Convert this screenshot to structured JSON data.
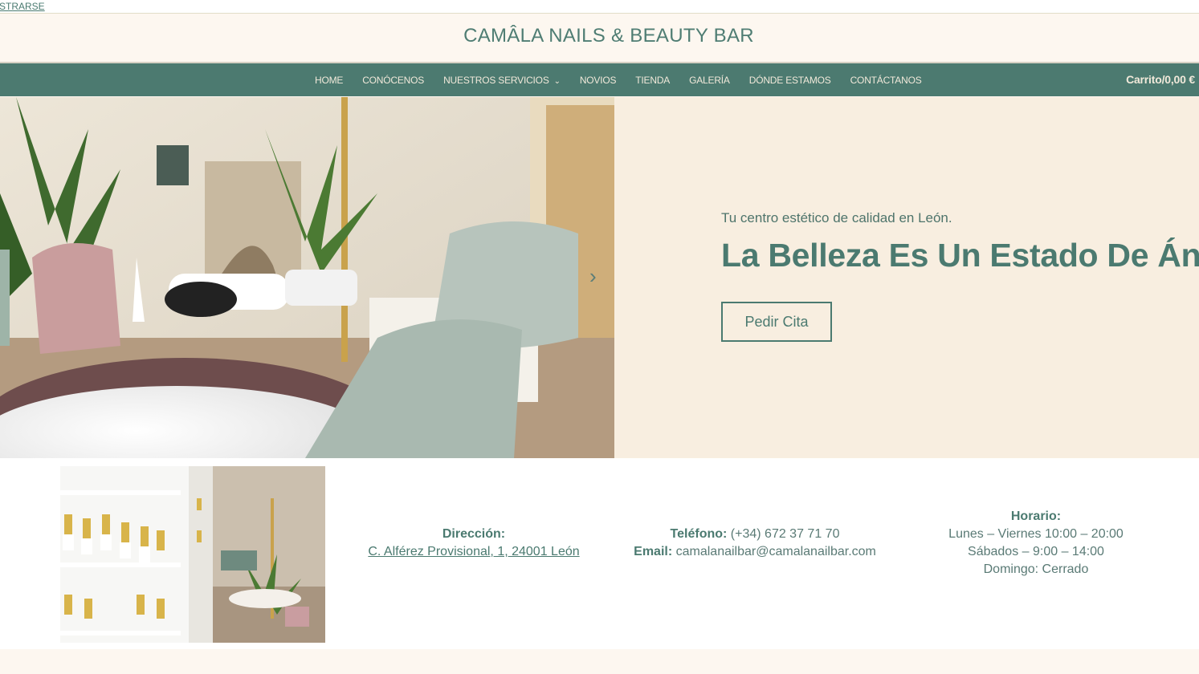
{
  "topbar": {
    "link": "STRARSE"
  },
  "header": {
    "brand": "CAMÂLA NAILS & BEAUTY BAR"
  },
  "nav": {
    "items": [
      "HOME",
      "CONÓCENOS",
      "NUESTROS SERVICIOS",
      "NOVIOS",
      "TIENDA",
      "GALERÍA",
      "DÓNDE ESTAMOS",
      "CONTÁCTANOS"
    ],
    "cart_label": "Carrito",
    "cart_separator": "/",
    "cart_total": "0,00 €"
  },
  "hero": {
    "subtitle": "Tu centro estético de calidad en León.",
    "title": "La Belleza Es Un Estado De Ánimo",
    "cta": "Pedir Cita",
    "next_icon": "chevron-right-icon"
  },
  "info": {
    "address_label": "Dirección:",
    "address": "C. Alférez Provisional, 1, 24001 León",
    "phone_label": "Teléfono:",
    "phone": "(+34) 672 37 71 70",
    "email_label": "Email:",
    "email": "camalanailbar@camalanailbar.com",
    "hours_label": "Horario:",
    "hours": [
      "Lunes – Viernes 10:00 – 20:00",
      "Sábados – 9:00 – 14:00",
      "Domingo: Cerrado"
    ]
  },
  "colors": {
    "brand_green": "#4c7a70",
    "cream": "#f8eee0",
    "page_bg": "#fdf7f0"
  }
}
